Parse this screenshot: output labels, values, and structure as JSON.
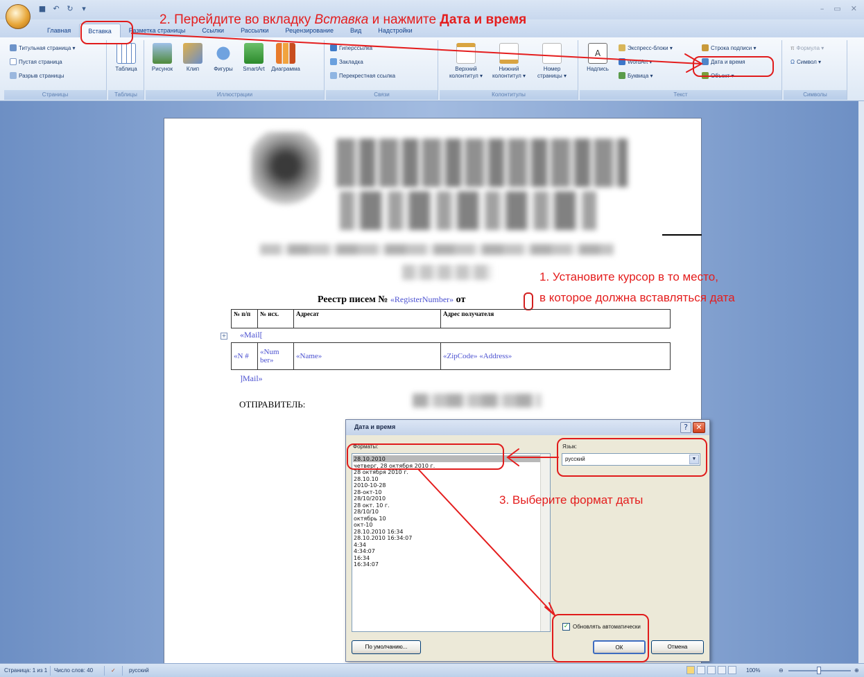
{
  "annotations": {
    "step2_prefix": "2. Перейдите во вкладку ",
    "step2_tab": "Вставка",
    "step2_middle": " и нажмите ",
    "step2_command": "Дата и время",
    "step1_line1": "1. Установите курсор в то место,",
    "step1_line2": "в которое должна вставляться дата",
    "step3": "3. Выберите формат даты",
    "accent_color": "#e41d1d"
  },
  "titlebar": {
    "office_button": "Office",
    "qat_icons": [
      "save-icon",
      "undo-icon",
      "redo-icon",
      "dropdown-icon"
    ],
    "window_controls": [
      "–",
      "▭",
      "✕"
    ]
  },
  "ribbon": {
    "tabs": [
      "Главная",
      "Вставка",
      "Разметка страницы",
      "Ссылки",
      "Рассылки",
      "Рецензирование",
      "Вид",
      "Надстройки"
    ],
    "active_tab": "Вставка",
    "groups": {
      "pages": {
        "label": "Страницы",
        "items": [
          "Титульная страница ▾",
          "Пустая страница",
          "Разрыв страницы"
        ]
      },
      "tables": {
        "label": "Таблицы",
        "item": "Таблица"
      },
      "illustrations": {
        "label": "Иллюстрации",
        "items": [
          "Рисунок",
          "Клип",
          "Фигуры",
          "SmartArt",
          "Диаграмма"
        ]
      },
      "links": {
        "label": "Связи",
        "items": [
          "Гиперссылка",
          "Закладка",
          "Перекрестная ссылка"
        ]
      },
      "header_footer": {
        "label": "Колонтитулы",
        "items": [
          {
            "l1": "Верхний",
            "l2": "колонтитул ▾"
          },
          {
            "l1": "Нижний",
            "l2": "колонтитул ▾"
          },
          {
            "l1": "Номер",
            "l2": "страницы ▾"
          }
        ]
      },
      "text": {
        "label": "Текст",
        "big_item": "Надпись",
        "items": [
          "Экспресс-блоки ▾",
          "WordArt ▾",
          "Буквица ▾",
          "Строка подписи ▾",
          "Дата и время",
          "Объект ▾"
        ]
      },
      "symbols": {
        "label": "Символы",
        "items": [
          "Формула ▾",
          "Символ ▾"
        ]
      }
    }
  },
  "document": {
    "register_title": "Реестр писем №",
    "register_field": "«RegisterNumber»",
    "from_label": "от",
    "table_headers": [
      "№ п/п",
      "№ исх.",
      "Адресат",
      "Адрес получателя"
    ],
    "mail_open": "«Mail[",
    "row": [
      "«N #",
      "«Num ber»",
      "«Name»",
      "«ZipCode» «Address»"
    ],
    "mail_close": "]Mail»",
    "sender_label": "ОТПРАВИТЕЛЬ:"
  },
  "dialog": {
    "title": "Дата и время",
    "formats_label": "Форматы:",
    "language_label": "Язык:",
    "language_value": "русский",
    "formats": [
      "28.10.2010",
      "четверг, 28 октября 2010 г.",
      "28 октября 2010 г.",
      "28.10.10",
      "2010-10-28",
      "28-окт-10",
      "28/10/2010",
      "28 окт. 10 г.",
      "28/10/10",
      "октябрь 10",
      "окт-10",
      "28.10.2010 16:34",
      "28.10.2010 16:34:07",
      "4:34",
      "4:34:07",
      "16:34",
      "16:34:07"
    ],
    "selected_format": "28.10.2010",
    "auto_update_label": "Обновлять автоматически",
    "auto_update_checked": true,
    "default_button": "По умолчанию...",
    "ok_button": "ОК",
    "cancel_button": "Отмена"
  },
  "statusbar": {
    "page": "Страница: 1 из 1",
    "words": "Число слов: 40",
    "language": "русский",
    "zoom": "100%"
  }
}
